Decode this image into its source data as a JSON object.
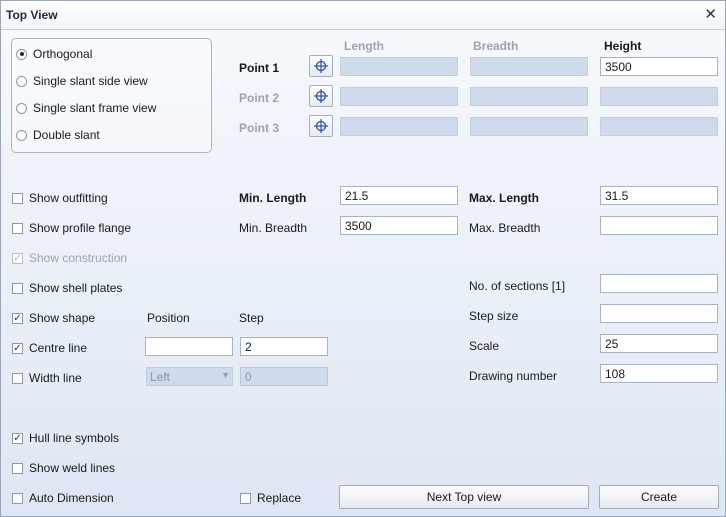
{
  "window": {
    "title": "Top View",
    "close_glyph": "✕"
  },
  "view_modes": {
    "options": [
      {
        "label": "Orthogonal",
        "selected": true
      },
      {
        "label": "Single slant side view",
        "selected": false
      },
      {
        "label": "Single slant frame view",
        "selected": false
      },
      {
        "label": "Double slant",
        "selected": false
      }
    ]
  },
  "points": {
    "headers": {
      "length": "Length",
      "breadth": "Breadth",
      "height": "Height"
    },
    "rows": [
      {
        "label": "Point 1",
        "length": "",
        "breadth": "",
        "height": "3500"
      },
      {
        "label": "Point 2",
        "length": "",
        "breadth": "",
        "height": ""
      },
      {
        "label": "Point 3",
        "length": "",
        "breadth": "",
        "height": ""
      }
    ],
    "pick_icon": "crosshair-icon"
  },
  "options": {
    "show_outfitting": {
      "label": "Show outfitting",
      "checked": false
    },
    "show_profile_flange": {
      "label": "Show profile flange",
      "checked": false
    },
    "show_construction": {
      "label": "Show construction",
      "checked": true,
      "disabled": true
    },
    "show_shell_plates": {
      "label": "Show shell plates",
      "checked": false
    },
    "show_shape": {
      "label": "Show shape",
      "checked": true
    },
    "centre_line": {
      "label": "Centre line",
      "checked": true
    },
    "width_line": {
      "label": "Width line",
      "checked": false
    },
    "hull_line_symbols": {
      "label": "Hull line symbols",
      "checked": true
    },
    "show_weld_lines": {
      "label": "Show weld lines",
      "checked": false
    },
    "auto_dimension": {
      "label": "Auto Dimension",
      "checked": false
    },
    "replace": {
      "label": "Replace",
      "checked": false
    }
  },
  "line_settings": {
    "position_header": "Position",
    "step_header": "Step",
    "centre_position": "",
    "centre_step": "2",
    "width_position": "Left",
    "width_step": "0"
  },
  "limits": {
    "min_length_label": "Min. Length",
    "min_length": "21.5",
    "max_length_label": "Max. Length",
    "max_length": "31.5",
    "min_breadth_label": "Min. Breadth",
    "min_breadth": "3500",
    "max_breadth_label": "Max. Breadth",
    "max_breadth": ""
  },
  "sections": {
    "no_sections_label": "No. of sections [1]",
    "no_sections": "",
    "step_size_label": "Step size",
    "step_size": "",
    "scale_label": "Scale",
    "scale": "25",
    "drawing_number_label": "Drawing number",
    "drawing_number": "108"
  },
  "buttons": {
    "next_top_view": "Next Top view",
    "create": "Create"
  }
}
